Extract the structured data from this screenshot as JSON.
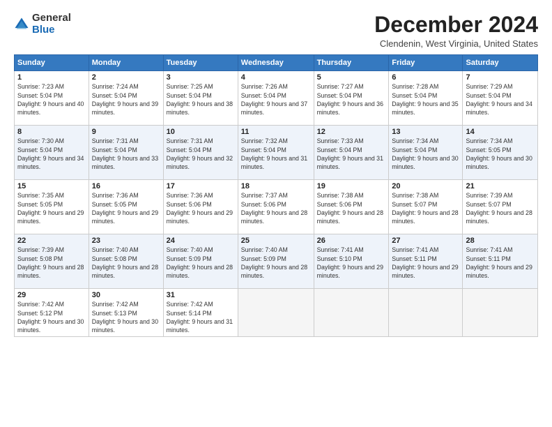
{
  "logo": {
    "general": "General",
    "blue": "Blue"
  },
  "title": "December 2024",
  "location": "Clendenin, West Virginia, United States",
  "days_header": [
    "Sunday",
    "Monday",
    "Tuesday",
    "Wednesday",
    "Thursday",
    "Friday",
    "Saturday"
  ],
  "weeks": [
    [
      {
        "day": "1",
        "sunrise": "7:23 AM",
        "sunset": "5:04 PM",
        "daylight": "9 hours and 40 minutes."
      },
      {
        "day": "2",
        "sunrise": "7:24 AM",
        "sunset": "5:04 PM",
        "daylight": "9 hours and 39 minutes."
      },
      {
        "day": "3",
        "sunrise": "7:25 AM",
        "sunset": "5:04 PM",
        "daylight": "9 hours and 38 minutes."
      },
      {
        "day": "4",
        "sunrise": "7:26 AM",
        "sunset": "5:04 PM",
        "daylight": "9 hours and 37 minutes."
      },
      {
        "day": "5",
        "sunrise": "7:27 AM",
        "sunset": "5:04 PM",
        "daylight": "9 hours and 36 minutes."
      },
      {
        "day": "6",
        "sunrise": "7:28 AM",
        "sunset": "5:04 PM",
        "daylight": "9 hours and 35 minutes."
      },
      {
        "day": "7",
        "sunrise": "7:29 AM",
        "sunset": "5:04 PM",
        "daylight": "9 hours and 34 minutes."
      }
    ],
    [
      {
        "day": "8",
        "sunrise": "7:30 AM",
        "sunset": "5:04 PM",
        "daylight": "9 hours and 34 minutes."
      },
      {
        "day": "9",
        "sunrise": "7:31 AM",
        "sunset": "5:04 PM",
        "daylight": "9 hours and 33 minutes."
      },
      {
        "day": "10",
        "sunrise": "7:31 AM",
        "sunset": "5:04 PM",
        "daylight": "9 hours and 32 minutes."
      },
      {
        "day": "11",
        "sunrise": "7:32 AM",
        "sunset": "5:04 PM",
        "daylight": "9 hours and 31 minutes."
      },
      {
        "day": "12",
        "sunrise": "7:33 AM",
        "sunset": "5:04 PM",
        "daylight": "9 hours and 31 minutes."
      },
      {
        "day": "13",
        "sunrise": "7:34 AM",
        "sunset": "5:04 PM",
        "daylight": "9 hours and 30 minutes."
      },
      {
        "day": "14",
        "sunrise": "7:34 AM",
        "sunset": "5:05 PM",
        "daylight": "9 hours and 30 minutes."
      }
    ],
    [
      {
        "day": "15",
        "sunrise": "7:35 AM",
        "sunset": "5:05 PM",
        "daylight": "9 hours and 29 minutes."
      },
      {
        "day": "16",
        "sunrise": "7:36 AM",
        "sunset": "5:05 PM",
        "daylight": "9 hours and 29 minutes."
      },
      {
        "day": "17",
        "sunrise": "7:36 AM",
        "sunset": "5:06 PM",
        "daylight": "9 hours and 29 minutes."
      },
      {
        "day": "18",
        "sunrise": "7:37 AM",
        "sunset": "5:06 PM",
        "daylight": "9 hours and 28 minutes."
      },
      {
        "day": "19",
        "sunrise": "7:38 AM",
        "sunset": "5:06 PM",
        "daylight": "9 hours and 28 minutes."
      },
      {
        "day": "20",
        "sunrise": "7:38 AM",
        "sunset": "5:07 PM",
        "daylight": "9 hours and 28 minutes."
      },
      {
        "day": "21",
        "sunrise": "7:39 AM",
        "sunset": "5:07 PM",
        "daylight": "9 hours and 28 minutes."
      }
    ],
    [
      {
        "day": "22",
        "sunrise": "7:39 AM",
        "sunset": "5:08 PM",
        "daylight": "9 hours and 28 minutes."
      },
      {
        "day": "23",
        "sunrise": "7:40 AM",
        "sunset": "5:08 PM",
        "daylight": "9 hours and 28 minutes."
      },
      {
        "day": "24",
        "sunrise": "7:40 AM",
        "sunset": "5:09 PM",
        "daylight": "9 hours and 28 minutes."
      },
      {
        "day": "25",
        "sunrise": "7:40 AM",
        "sunset": "5:09 PM",
        "daylight": "9 hours and 28 minutes."
      },
      {
        "day": "26",
        "sunrise": "7:41 AM",
        "sunset": "5:10 PM",
        "daylight": "9 hours and 29 minutes."
      },
      {
        "day": "27",
        "sunrise": "7:41 AM",
        "sunset": "5:11 PM",
        "daylight": "9 hours and 29 minutes."
      },
      {
        "day": "28",
        "sunrise": "7:41 AM",
        "sunset": "5:11 PM",
        "daylight": "9 hours and 29 minutes."
      }
    ],
    [
      {
        "day": "29",
        "sunrise": "7:42 AM",
        "sunset": "5:12 PM",
        "daylight": "9 hours and 30 minutes."
      },
      {
        "day": "30",
        "sunrise": "7:42 AM",
        "sunset": "5:13 PM",
        "daylight": "9 hours and 30 minutes."
      },
      {
        "day": "31",
        "sunrise": "7:42 AM",
        "sunset": "5:14 PM",
        "daylight": "9 hours and 31 minutes."
      },
      null,
      null,
      null,
      null
    ]
  ],
  "labels": {
    "sunrise": "Sunrise:",
    "sunset": "Sunset:",
    "daylight": "Daylight:"
  }
}
